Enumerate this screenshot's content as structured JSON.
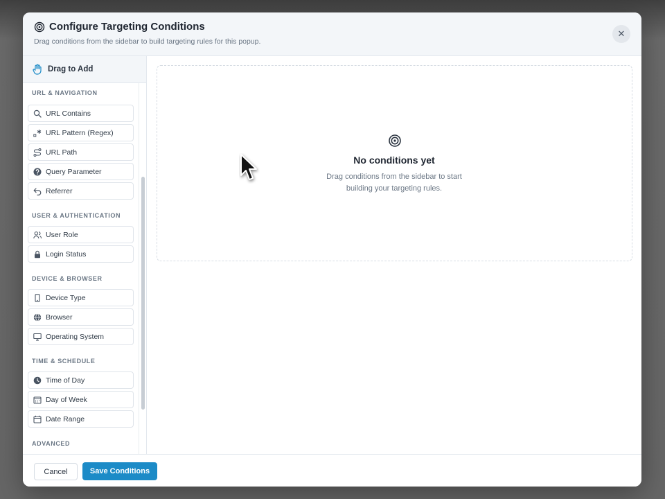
{
  "modal": {
    "title": "Configure Targeting Conditions",
    "subtitle": "Drag conditions from the sidebar to build targeting rules for this popup.",
    "close_icon": "close-icon",
    "title_icon": "target-icon"
  },
  "sidebar": {
    "heading": "Drag to Add",
    "heading_icon": "hand-icon",
    "sections": [
      {
        "title": "URL & Navigation",
        "items": [
          {
            "label": "URL Contains",
            "icon": "search-icon"
          },
          {
            "label": "URL Pattern (Regex)",
            "icon": "regex-icon"
          },
          {
            "label": "URL Path",
            "icon": "route-icon"
          },
          {
            "label": "Query Parameter",
            "icon": "question-circle-icon"
          },
          {
            "label": "Referrer",
            "icon": "undo-arrow-icon"
          }
        ]
      },
      {
        "title": "User & Authentication",
        "items": [
          {
            "label": "User Role",
            "icon": "users-icon"
          },
          {
            "label": "Login Status",
            "icon": "lock-icon"
          }
        ]
      },
      {
        "title": "Device & Browser",
        "items": [
          {
            "label": "Device Type",
            "icon": "smartphone-icon"
          },
          {
            "label": "Browser",
            "icon": "globe-icon"
          },
          {
            "label": "Operating System",
            "icon": "monitor-icon"
          }
        ]
      },
      {
        "title": "Time & Schedule",
        "items": [
          {
            "label": "Time of Day",
            "icon": "clock-icon"
          },
          {
            "label": "Day of Week",
            "icon": "calendar-week-icon"
          },
          {
            "label": "Date Range",
            "icon": "calendar-icon"
          }
        ]
      },
      {
        "title": "Advanced",
        "items": []
      }
    ]
  },
  "empty_state": {
    "icon": "target-icon",
    "title": "No conditions yet",
    "description": "Drag conditions from the sidebar to start building your targeting rules."
  },
  "footer": {
    "cancel_label": "Cancel",
    "save_label": "Save Conditions"
  },
  "colors": {
    "primary": "#1c8bc7",
    "header_bg": "#f3f6f9"
  }
}
